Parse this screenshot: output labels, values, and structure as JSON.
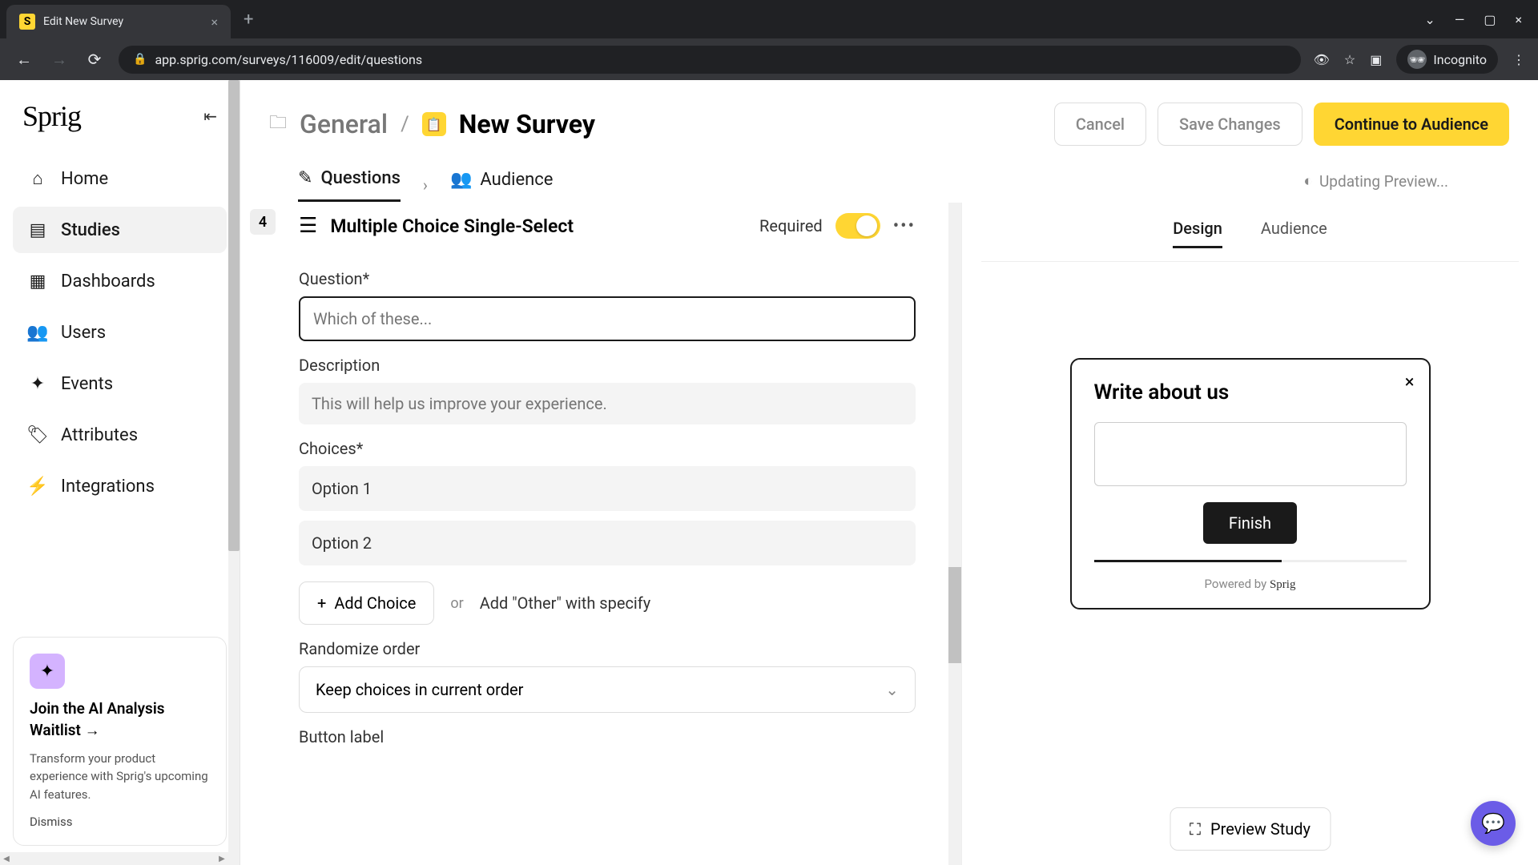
{
  "browser": {
    "tab_title": "Edit New Survey",
    "tab_favicon_letter": "S",
    "url": "app.sprig.com/surveys/116009/edit/questions",
    "incognito_label": "Incognito"
  },
  "sidebar": {
    "logo": "Sprig",
    "items": [
      {
        "label": "Home"
      },
      {
        "label": "Studies"
      },
      {
        "label": "Dashboards"
      },
      {
        "label": "Users"
      },
      {
        "label": "Events"
      },
      {
        "label": "Attributes"
      },
      {
        "label": "Integrations"
      }
    ],
    "promo": {
      "title": "Join the AI Analysis Waitlist →",
      "text": "Transform your product experience with Sprig's upcoming AI features.",
      "dismiss": "Dismiss"
    }
  },
  "breadcrumb": {
    "folder": "General",
    "title": "New Survey"
  },
  "actions": {
    "cancel": "Cancel",
    "save": "Save Changes",
    "continue": "Continue to Audience"
  },
  "updating": "Updating Preview...",
  "tabs": {
    "questions": "Questions",
    "audience": "Audience"
  },
  "question": {
    "number": "4",
    "type": "Multiple Choice Single-Select",
    "required_label": "Required",
    "question_label": "Question*",
    "question_placeholder": "Which of these...",
    "description_label": "Description",
    "description_placeholder": "This will help us improve your experience.",
    "choices_label": "Choices*",
    "choices": [
      "Option 1",
      "Option 2"
    ],
    "add_choice": "Add Choice",
    "or": "or",
    "add_other": "Add \"Other\" with specify",
    "randomize_label": "Randomize order",
    "randomize_value": "Keep choices in current order",
    "button_label_label": "Button label"
  },
  "preview": {
    "tabs": {
      "design": "Design",
      "audience": "Audience"
    },
    "widget_title": "Write about us",
    "finish": "Finish",
    "powered_by": "Powered by",
    "brand": "Sprig",
    "preview_study": "Preview Study"
  }
}
